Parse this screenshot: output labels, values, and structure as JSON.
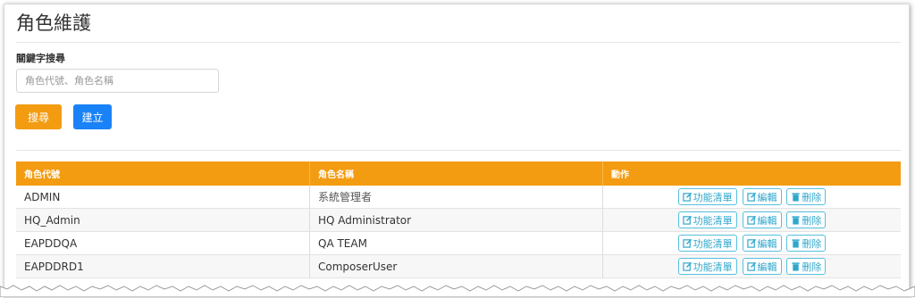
{
  "page": {
    "title": "角色維護"
  },
  "search": {
    "label": "關鍵字搜尋",
    "placeholder": "角色代號、角色名稱",
    "value": "",
    "search_button": "搜尋",
    "create_button": "建立"
  },
  "table": {
    "headers": [
      "角色代號",
      "角色名稱",
      "動作"
    ],
    "rows": [
      {
        "code": "ADMIN",
        "name": "系統管理者"
      },
      {
        "code": "HQ_Admin",
        "name": "HQ Administrator"
      },
      {
        "code": "EAPDDQA",
        "name": "QA TEAM"
      },
      {
        "code": "EAPDDRD1",
        "name": "ComposerUser"
      }
    ],
    "actions": {
      "functions": "功能清單",
      "edit": "編輯",
      "delete": "刪除"
    }
  },
  "colors": {
    "accent": "#f39c12",
    "primary": "#1a82f7",
    "action_outline": "#55c0dd"
  },
  "icons": {
    "edit": "edit-icon",
    "delete": "trash-icon"
  }
}
